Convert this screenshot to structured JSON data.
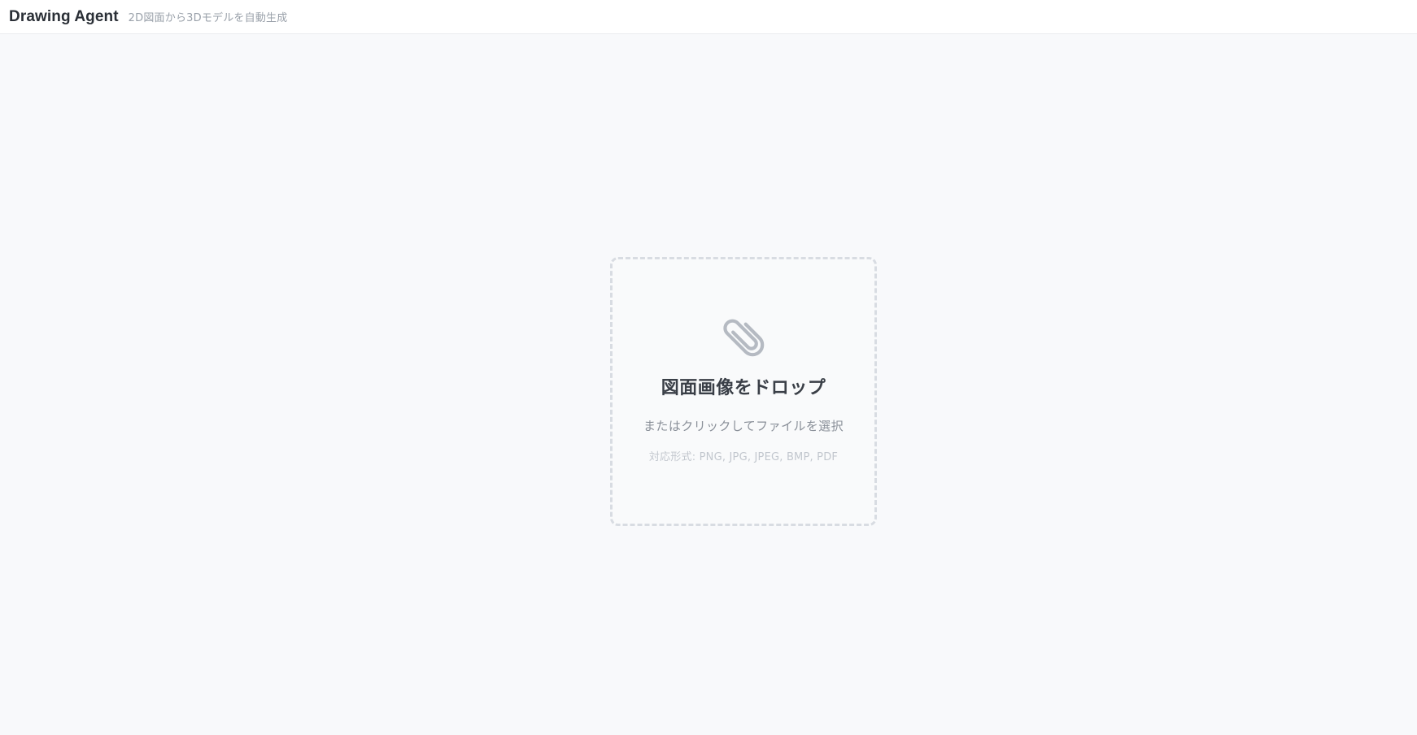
{
  "header": {
    "title": "Drawing Agent",
    "subtitle": "2D図面から3Dモデルを自動生成"
  },
  "dropzone": {
    "icon": "paperclip-icon",
    "title": "図面画像をドロップ",
    "hint": "またはクリックしてファイルを選択",
    "formats": "対応形式: PNG, JPG, JPEG, BMP, PDF"
  },
  "colors": {
    "background": "#f8f9fb",
    "header_bg": "#ffffff",
    "dropzone_border": "#d8dce2",
    "icon": "#b5bac2",
    "title_text": "#3a3f47",
    "hint_text": "#8a9099",
    "formats_text": "#c2c7ce"
  }
}
